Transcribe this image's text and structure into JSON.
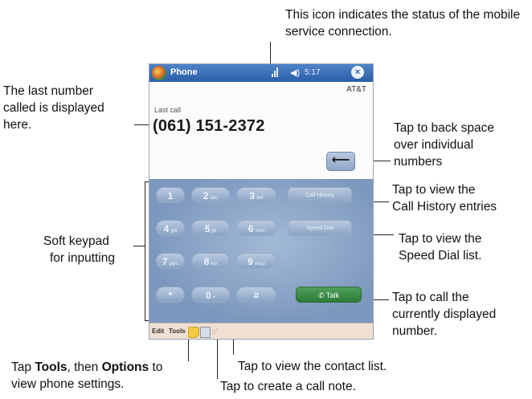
{
  "annotations": {
    "status_icon": "This icon indicates the status of the mobile service connection.",
    "last_number_1": "The last number",
    "last_number_2": "called is displayed",
    "last_number_3": "here.",
    "backspace_1": "Tap to back space",
    "backspace_2": "over individual",
    "backspace_3": "numbers",
    "call_history_1": "Tap to view the",
    "call_history_2": "Call History entries",
    "soft_keypad_1": "Soft keypad",
    "soft_keypad_2": "for inputting",
    "speed_dial_1": "Tap to view the",
    "speed_dial_2": "Speed Dial list.",
    "talk_1": "Tap to call the",
    "talk_2": "currently displayed",
    "talk_3": "number.",
    "tools_pre": "Tap ",
    "tools_word": "Tools",
    "tools_mid": ", then ",
    "options_word": "Options",
    "tools_post": " to",
    "tools_line2": "view phone settings.",
    "contacts": "Tap to view the contact list.",
    "call_note": "Tap to create a call note."
  },
  "phone": {
    "app_title": "Phone",
    "clock": "5:17",
    "carrier": "AT&T",
    "last_call_label": "Last call",
    "number": "(061) 151-2372"
  },
  "icons": {
    "start": "windows-start-icon",
    "signal": "signal-strength-icon",
    "volume": "speaker-icon",
    "close": "close-icon",
    "backspace": "left-arrow-icon",
    "talk": "phone-handset-icon",
    "note": "call-note-icon",
    "contacts": "contacts-icon"
  },
  "keypad": {
    "keys": [
      {
        "digit": "1",
        "letters": ""
      },
      {
        "digit": "2",
        "letters": "abc"
      },
      {
        "digit": "3",
        "letters": "def"
      },
      {
        "digit": "4",
        "letters": "ghi"
      },
      {
        "digit": "5",
        "letters": "jkl"
      },
      {
        "digit": "6",
        "letters": "mno"
      },
      {
        "digit": "7",
        "letters": "pqrs"
      },
      {
        "digit": "8",
        "letters": "tuv"
      },
      {
        "digit": "9",
        "letters": "wxyz"
      },
      {
        "digit": "*",
        "letters": ""
      },
      {
        "digit": "0",
        "letters": "+"
      },
      {
        "digit": "#",
        "letters": ""
      }
    ],
    "call_history_label": "Call History",
    "speed_dial_label": "Speed Dial",
    "talk_label": "Talk"
  },
  "menubar": {
    "edit_label": "Edit",
    "tools_label": "Tools"
  }
}
